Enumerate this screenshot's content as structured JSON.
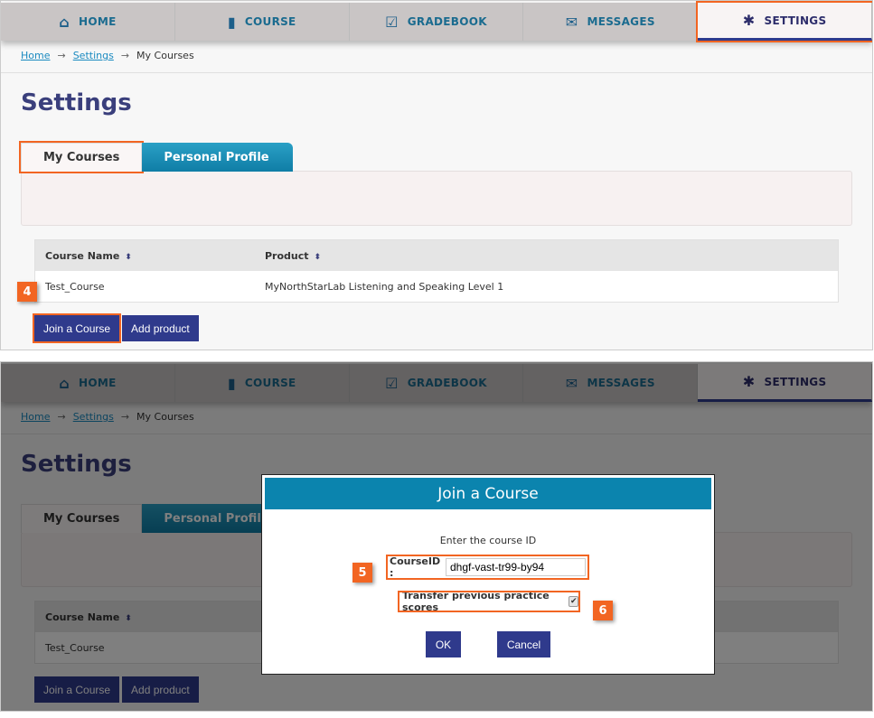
{
  "nav": [
    {
      "label": "HOME",
      "icon": "home-icon",
      "glyph": "⌂"
    },
    {
      "label": "COURSE",
      "icon": "book-icon",
      "glyph": "▮"
    },
    {
      "label": "GRADEBOOK",
      "icon": "gradebook-icon",
      "glyph": "☑"
    },
    {
      "label": "MESSAGES",
      "icon": "envelope-icon",
      "glyph": "✉"
    },
    {
      "label": "SETTINGS",
      "icon": "gear-icon",
      "glyph": "✱"
    }
  ],
  "breadcrumb": {
    "home": "Home",
    "settings": "Settings",
    "current": "My Courses",
    "arrow": "→"
  },
  "page_title": "Settings",
  "tabs": {
    "my_courses": "My Courses",
    "personal_profile": "Personal Profile"
  },
  "table": {
    "headers": [
      "Course Name",
      "Product"
    ],
    "sort_glyph": "⬍",
    "rows": [
      [
        "Test_Course",
        "MyNorthStarLab Listening and Speaking Level 1"
      ]
    ]
  },
  "buttons": {
    "join": "Join a Course",
    "add": "Add product"
  },
  "callouts": [
    "4",
    "5",
    "6"
  ],
  "modal": {
    "title": "Join a Course",
    "instruction": "Enter the course ID",
    "courseid_label": "CourseID :",
    "courseid_value": "dhgf-vast-tr99-by94",
    "transfer_label": "Transfer previous practice scores",
    "transfer_checked": true,
    "ok": "OK",
    "cancel": "Cancel"
  },
  "colors": {
    "highlight": "#f26522",
    "primary": "#2f3a8c",
    "modal_header": "#0b84ae"
  }
}
